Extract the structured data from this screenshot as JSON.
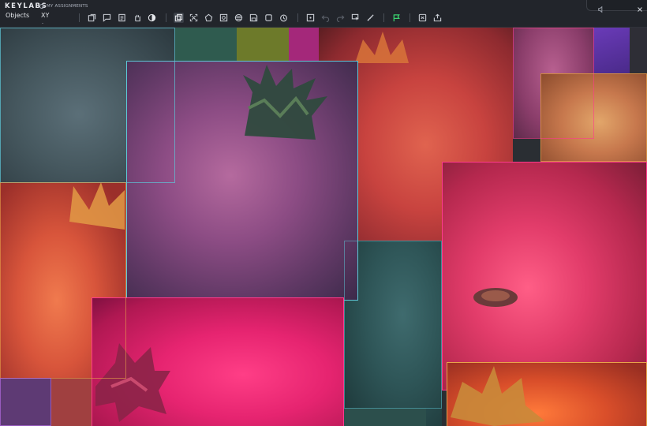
{
  "app": {
    "brand": "KEYLABS",
    "assignments_label": "MY ASSIGNMENTS"
  },
  "menu": {
    "objects_label": "Objects",
    "xy_label": "XY",
    "xy_caret": "-"
  },
  "toolbar": {
    "tools": [
      {
        "name": "bbox-tool-icon",
        "active": false
      },
      {
        "name": "comment-icon",
        "active": false
      },
      {
        "name": "note-icon",
        "active": false
      },
      {
        "name": "hand-icon",
        "active": false
      },
      {
        "name": "contrast-icon",
        "active": false
      },
      {
        "name": "copy-icon",
        "active": true
      },
      {
        "name": "expand-icon",
        "active": false
      },
      {
        "name": "shape-icon",
        "active": false
      },
      {
        "name": "tag-icon",
        "active": false
      },
      {
        "name": "pattern-icon",
        "active": false
      },
      {
        "name": "save-icon",
        "active": false
      },
      {
        "name": "frame-icon",
        "active": false
      },
      {
        "name": "timer-icon",
        "active": false
      },
      {
        "name": "crosshair-icon",
        "active": false
      },
      {
        "name": "undo-icon",
        "active": false
      },
      {
        "name": "redo-icon",
        "active": false
      },
      {
        "name": "cursor-icon",
        "active": false
      },
      {
        "name": "ruler-icon",
        "active": false
      },
      {
        "name": "flag-icon",
        "active": false
      },
      {
        "name": "grid-icon",
        "active": false
      },
      {
        "name": "export-icon",
        "active": false
      }
    ],
    "flag_color": "#3bd16f"
  },
  "window": {
    "sound_icon": "speaker-icon",
    "close_icon": "close-icon"
  },
  "colors": {
    "topbar": "#22252b",
    "annotation_cyan": "#5ec8d8",
    "annotation_pink": "#ff3a8c",
    "annotation_orange": "#e8a34a"
  }
}
